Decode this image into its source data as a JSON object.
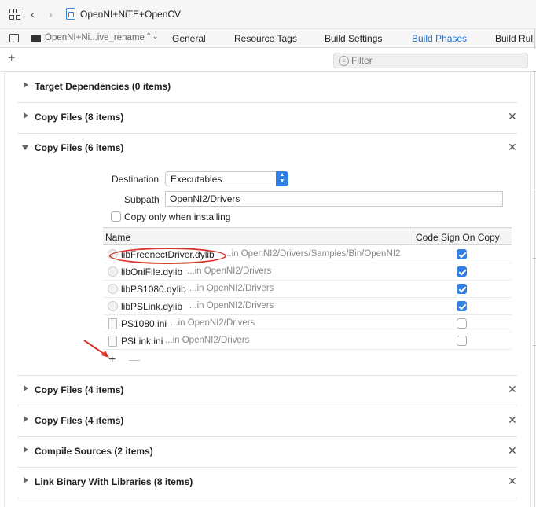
{
  "window": {
    "title": "OpenNI+NiTE+OpenCV",
    "target": "OpenNI+Ni...ive_rename"
  },
  "tabs": [
    {
      "label": "General"
    },
    {
      "label": "Resource Tags"
    },
    {
      "label": "Build Settings"
    },
    {
      "label": "Build Phases",
      "active": true
    },
    {
      "label": "Build Rul"
    }
  ],
  "filter": {
    "placeholder": "Filter"
  },
  "phases": {
    "target_deps": "Target Dependencies (0 items)",
    "copy1": "Copy Files (8 items)",
    "copy2": "Copy Files (6 items)",
    "copy3": "Copy Files (4 items)",
    "copy4": "Copy Files (4 items)",
    "compile": "Compile Sources (2 items)",
    "link": "Link Binary With Libraries (8 items)"
  },
  "expanded": {
    "destination_label": "Destination",
    "destination_value": "Executables",
    "subpath_label": "Subpath",
    "subpath_value": "OpenNI2/Drivers",
    "copy_only_label": "Copy only when installing",
    "copy_only_checked": false,
    "col_name": "Name",
    "col_codesign": "Code Sign On Copy",
    "files": [
      {
        "name": "libFreenectDriver.dylib",
        "path": "...in OpenNI2/Drivers/Samples/Bin/OpenNI2",
        "codesign": true
      },
      {
        "name": "libOniFile.dylib",
        "path": "...in OpenNI2/Drivers",
        "codesign": true
      },
      {
        "name": "libPS1080.dylib",
        "path": "...in OpenNI2/Drivers",
        "codesign": true
      },
      {
        "name": "libPSLink.dylib",
        "path": "...in OpenNI2/Drivers",
        "codesign": true
      },
      {
        "name": "PS1080.ini",
        "path": "...in OpenNI2/Drivers",
        "codesign": false
      },
      {
        "name": "PSLink.ini",
        "path": "...in OpenNI2/Drivers",
        "codesign": false
      }
    ]
  },
  "colors": {
    "accent": "#2f7fe6",
    "annotation": "#d9342b"
  }
}
